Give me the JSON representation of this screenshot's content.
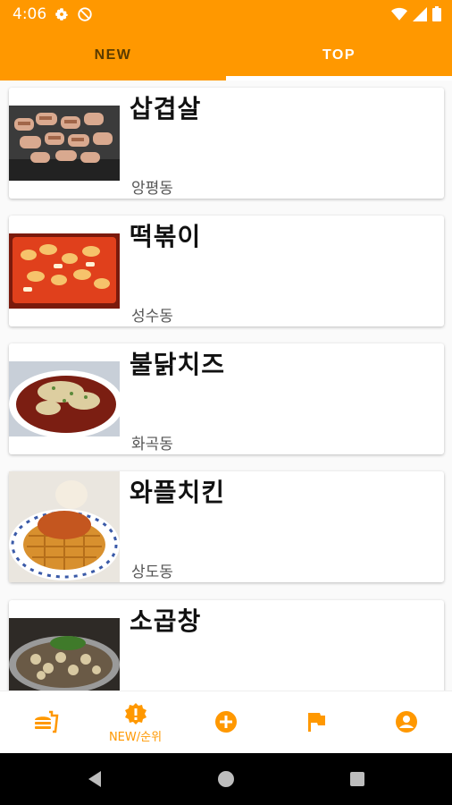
{
  "status_bar": {
    "time": "4:06"
  },
  "tabs": [
    {
      "label": "NEW",
      "selected": false
    },
    {
      "label": "TOP",
      "selected": true
    }
  ],
  "colors": {
    "accent": "#FF9800",
    "tab_text_inactive": "#5a3b00"
  },
  "restaurants": [
    {
      "title": "삽겹살",
      "location": "앙평동",
      "image_icon": "grilled-pork-photo"
    },
    {
      "title": "떡볶이",
      "location": "성수동",
      "image_icon": "tteokbokki-photo"
    },
    {
      "title": "불닭치즈",
      "location": "화곡동",
      "image_icon": "buldak-cheese-photo"
    },
    {
      "title": "와플치킨",
      "location": "상도동",
      "image_icon": "waffle-chicken-photo"
    },
    {
      "title": "소곱창",
      "location": "",
      "image_icon": "gopchang-photo"
    }
  ],
  "bottom_nav": [
    {
      "icon": "fastfood-icon",
      "label": ""
    },
    {
      "icon": "new-ranking-icon",
      "label": "NEW/순위"
    },
    {
      "icon": "add-circle-icon",
      "label": ""
    },
    {
      "icon": "flag-icon",
      "label": ""
    },
    {
      "icon": "account-circle-icon",
      "label": ""
    }
  ]
}
